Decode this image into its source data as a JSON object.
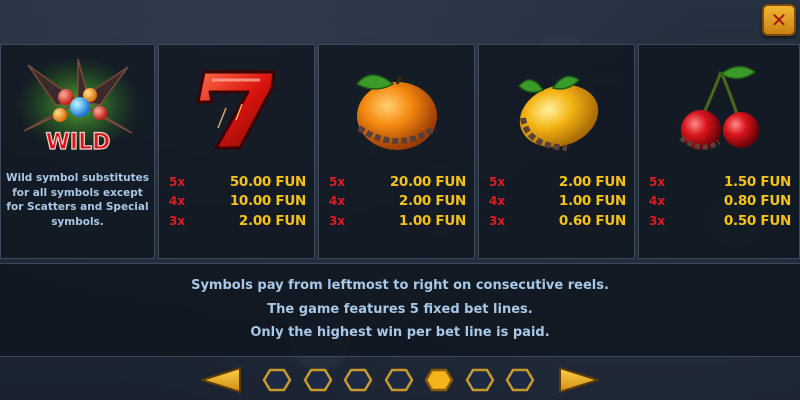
{
  "colors": {
    "multiplier": "#d81e1e",
    "amount": "#f4c21a",
    "description_text": "#a9c8e6",
    "panel_border": "#3b4a5e",
    "close_button": "#e8a623"
  },
  "close_button": {
    "label": "✕",
    "icon": "close-icon"
  },
  "wild": {
    "logo_text": "WILD",
    "description": "Wild symbol substitutes for all symbols except for Scatters and Special symbols.",
    "icon": "wild-flower-icon"
  },
  "paytable": [
    {
      "symbol": "seven-icon",
      "payouts": [
        {
          "multiplier": "5x",
          "amount": "50.00 FUN"
        },
        {
          "multiplier": "4x",
          "amount": "10.00 FUN"
        },
        {
          "multiplier": "3x",
          "amount": "2.00 FUN"
        }
      ]
    },
    {
      "symbol": "orange-icon",
      "payouts": [
        {
          "multiplier": "5x",
          "amount": "20.00 FUN"
        },
        {
          "multiplier": "4x",
          "amount": "2.00 FUN"
        },
        {
          "multiplier": "3x",
          "amount": "1.00 FUN"
        }
      ]
    },
    {
      "symbol": "lemon-icon",
      "payouts": [
        {
          "multiplier": "5x",
          "amount": "2.00 FUN"
        },
        {
          "multiplier": "4x",
          "amount": "1.00 FUN"
        },
        {
          "multiplier": "3x",
          "amount": "0.60 FUN"
        }
      ]
    },
    {
      "symbol": "cherries-icon",
      "payouts": [
        {
          "multiplier": "5x",
          "amount": "1.50 FUN"
        },
        {
          "multiplier": "4x",
          "amount": "0.80 FUN"
        },
        {
          "multiplier": "3x",
          "amount": "0.50 FUN"
        }
      ]
    }
  ],
  "info": {
    "lines": [
      "Symbols pay from leftmost to right on consecutive reels.",
      "The game features 5 fixed bet lines.",
      "Only the highest win per bet line is paid."
    ]
  },
  "pagination": {
    "total_pages": 7,
    "current_page": 5,
    "prev_icon": "arrow-left-icon",
    "next_icon": "arrow-right-icon"
  }
}
